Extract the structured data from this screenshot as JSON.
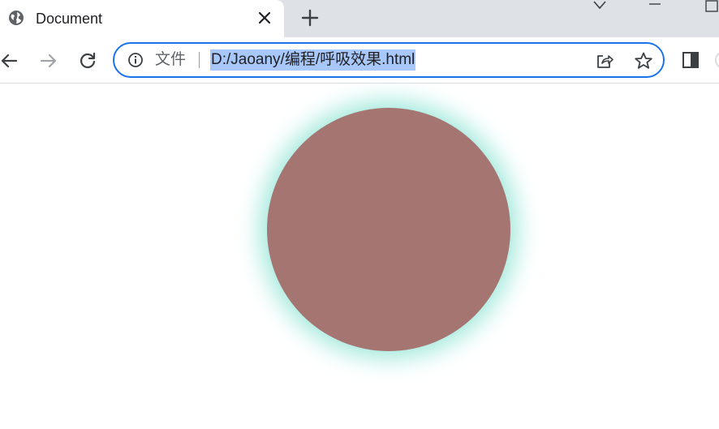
{
  "tab": {
    "title": "Document",
    "favicon": "globe-icon"
  },
  "toolbar": {
    "back": "arrow-left-icon",
    "forward": "arrow-right-icon",
    "reload": "reload-icon"
  },
  "omnibox": {
    "scheme_label": "文件",
    "url": "D:/Jaoany/编程/呼吸效果.html",
    "info_icon": "info-icon",
    "share_icon": "share-icon",
    "bookmark_icon": "star-icon"
  },
  "page": {
    "circle_color": "#a57572",
    "glow_color": "#9be7d9"
  },
  "colors": {
    "focus_ring": "#1a73e8",
    "url_highlight": "#a8c7fa",
    "tabstrip": "#dee1e6"
  }
}
